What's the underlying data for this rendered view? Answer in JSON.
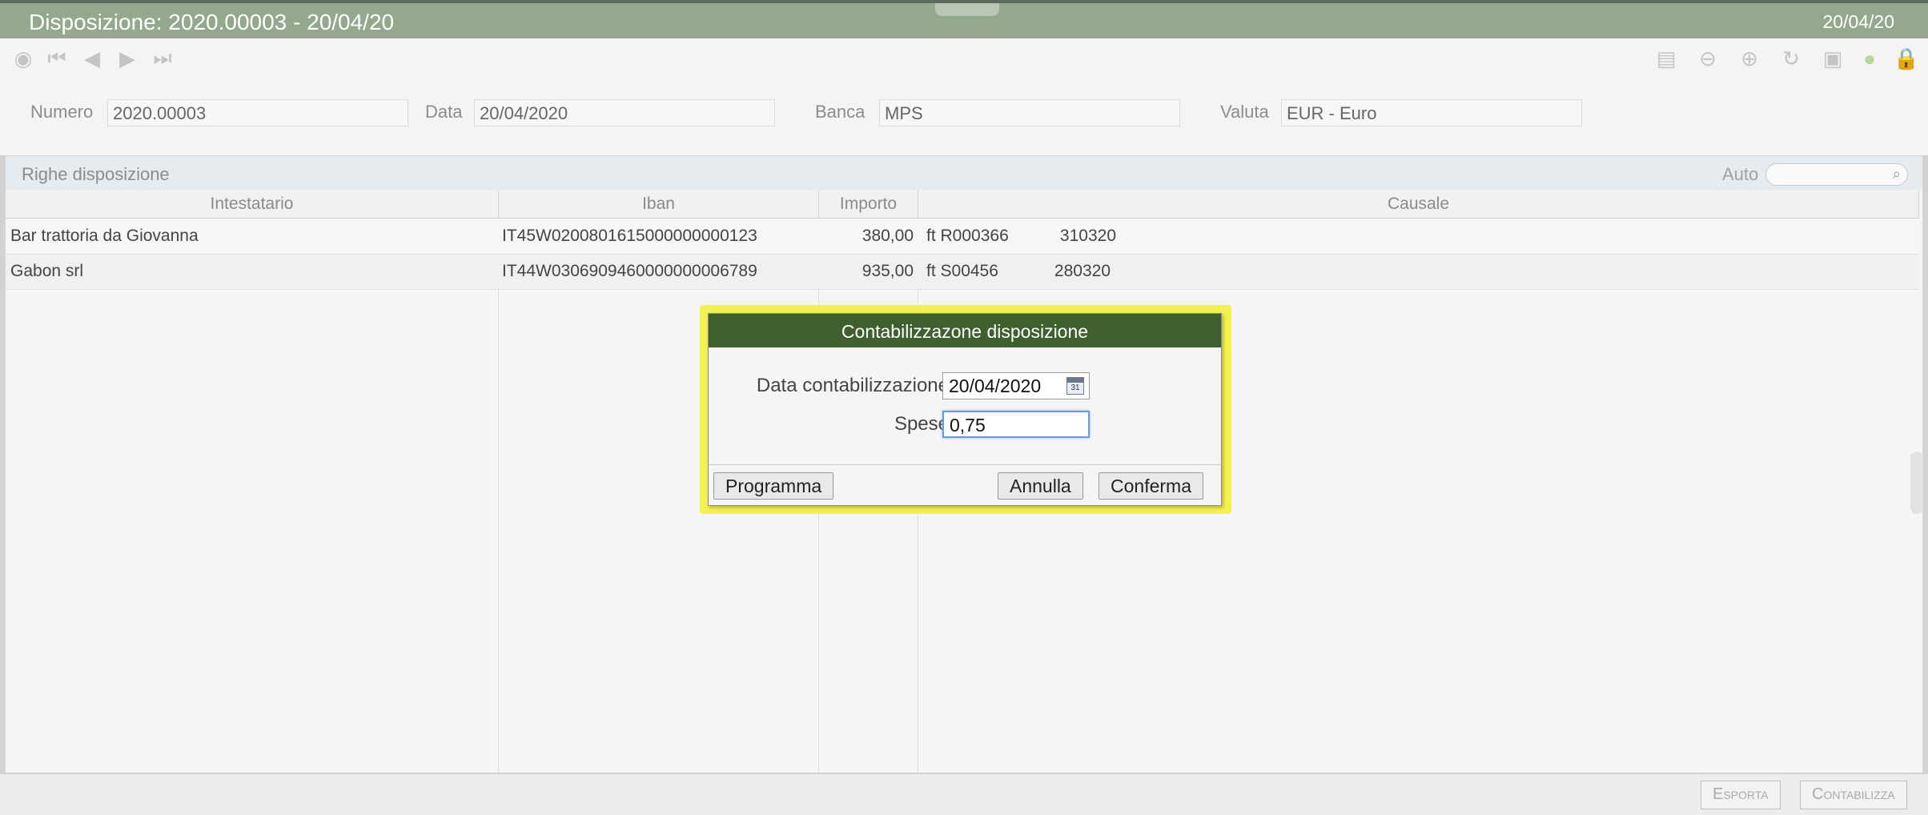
{
  "window": {
    "title": "Disposizione: 2020.00003 - 20/04/20",
    "date": "20/04/20"
  },
  "toolbar": {
    "left_icons": [
      "home-icon",
      "first-record-icon",
      "previous-record-icon",
      "next-record-icon",
      "last-record-icon"
    ],
    "right_icons": [
      "archive-icon",
      "remove-icon",
      "add-icon",
      "refresh-icon",
      "save-icon",
      "status-dot-icon",
      "lock-icon"
    ]
  },
  "header": {
    "numero_label": "Numero",
    "numero_value": "2020.00003",
    "data_label": "Data",
    "data_value": "20/04/2020",
    "banca_label": "Banca",
    "banca_value": "MPS",
    "valuta_label": "Valuta",
    "valuta_value": "EUR - Euro"
  },
  "grid": {
    "title": "Righe disposizione",
    "auto_label": "Auto",
    "columns": [
      "Intestatario",
      "Iban",
      "Importo",
      "Causale"
    ],
    "rows": [
      {
        "intestatario": "Bar trattoria da Giovanna",
        "iban": "IT45W0200801615000000000123",
        "importo": "380,00",
        "causale": "ft R000366           310320"
      },
      {
        "intestatario": "Gabon srl",
        "iban": "IT44W0306909460000000006789",
        "importo": "935,00",
        "causale": "ft S00456            280320"
      }
    ]
  },
  "dialog": {
    "title": "Contabilizzazone disposizione",
    "data_label": "Data contabilizzazione",
    "data_value": "20/04/2020",
    "spese_label": "Spese",
    "spese_value": "0,75",
    "programma_label": "Programma",
    "annulla_label": "Annulla",
    "conferma_label": "Conferma",
    "highlight_color": "#f3f052",
    "title_color": "#3f5f2f"
  },
  "footer": {
    "esporta_label": "Esporta",
    "contabilizza_label": "Contabilizza"
  },
  "colors": {
    "title_bar": "#93a88c",
    "accent_green": "#3f5f2f"
  }
}
